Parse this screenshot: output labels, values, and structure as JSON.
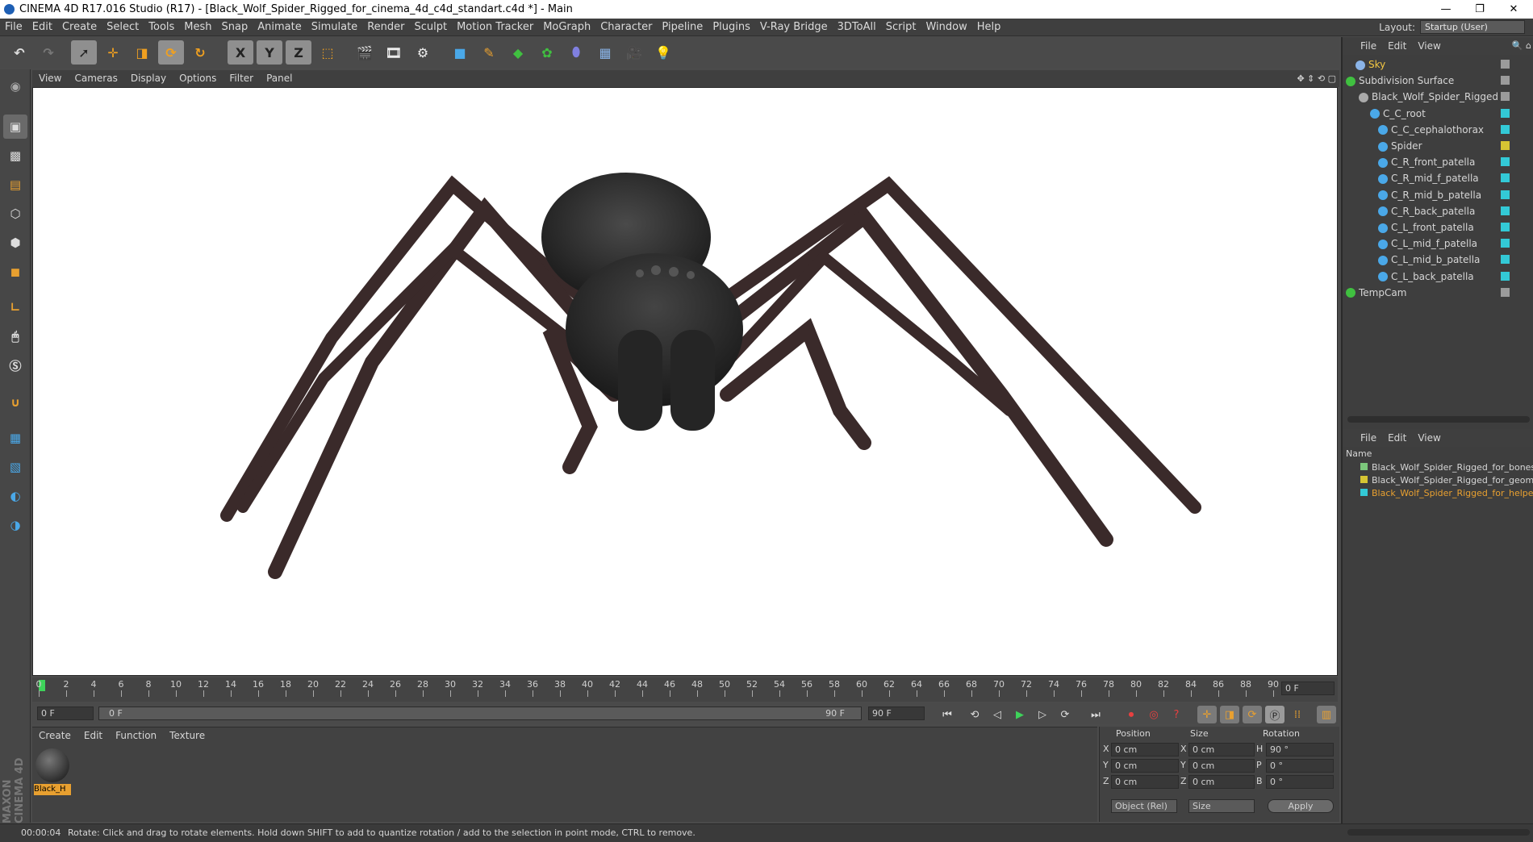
{
  "window": {
    "title": "CINEMA 4D R17.016 Studio (R17) - [Black_Wolf_Spider_Rigged_for_cinema_4d_c4d_standart.c4d *] - Main"
  },
  "menu": [
    "File",
    "Edit",
    "Create",
    "Select",
    "Tools",
    "Mesh",
    "Snap",
    "Animate",
    "Simulate",
    "Render",
    "Sculpt",
    "Motion Tracker",
    "MoGraph",
    "Character",
    "Pipeline",
    "Plugins",
    "V-Ray Bridge",
    "3DToAll",
    "Script",
    "Window",
    "Help"
  ],
  "layout": {
    "label": "Layout:",
    "value": "Startup (User)"
  },
  "toolbar": {
    "x_label": "X",
    "y_label": "Y",
    "z_label": "Z"
  },
  "viewport_menu": [
    "View",
    "Cameras",
    "Display",
    "Options",
    "Filter",
    "Panel"
  ],
  "object_manager": {
    "menu": [
      "File",
      "Edit",
      "View"
    ],
    "objects": [
      {
        "name": "Sky",
        "tag": "#9b9b9b",
        "highlight": "#f5c842"
      },
      {
        "name": "Subdivision Surface",
        "tag": "#9b9b9b"
      },
      {
        "name": "Black_Wolf_Spider_Rigged",
        "tag": "#9b9b9b"
      },
      {
        "name": "C_C_root",
        "tag": "#33c9d6"
      },
      {
        "name": "C_C_cephalothorax",
        "tag": "#33c9d6"
      },
      {
        "name": "Spider",
        "tag": "#d6c533"
      },
      {
        "name": "C_R_front_patella",
        "tag": "#33c9d6"
      },
      {
        "name": "C_R_mid_f_patella",
        "tag": "#33c9d6"
      },
      {
        "name": "C_R_mid_b_patella",
        "tag": "#33c9d6"
      },
      {
        "name": "C_R_back_patella",
        "tag": "#33c9d6"
      },
      {
        "name": "C_L_front_patella",
        "tag": "#33c9d6"
      },
      {
        "name": "C_L_mid_f_patella",
        "tag": "#33c9d6"
      },
      {
        "name": "C_L_mid_b_patella",
        "tag": "#33c9d6"
      },
      {
        "name": "C_L_back_patella",
        "tag": "#33c9d6"
      },
      {
        "name": "TempCam",
        "tag": "#9b9b9b"
      }
    ]
  },
  "layer_manager": {
    "menu": [
      "File",
      "Edit",
      "View"
    ],
    "column": "Name",
    "layers": [
      {
        "name": "Black_Wolf_Spider_Rigged_for_bones",
        "color": "#7cc87c"
      },
      {
        "name": "Black_Wolf_Spider_Rigged_for_geom",
        "color": "#d6c533"
      },
      {
        "name": "Black_Wolf_Spider_Rigged_for_helpe",
        "color": "#33c9d6"
      }
    ]
  },
  "timeline": {
    "ticks": [
      "0",
      "2",
      "4",
      "6",
      "8",
      "10",
      "12",
      "14",
      "16",
      "18",
      "20",
      "22",
      "24",
      "26",
      "28",
      "30",
      "32",
      "34",
      "36",
      "38",
      "40",
      "42",
      "44",
      "46",
      "48",
      "50",
      "52",
      "54",
      "56",
      "58",
      "60",
      "62",
      "64",
      "66",
      "68",
      "70",
      "72",
      "74",
      "76",
      "78",
      "80",
      "82",
      "84",
      "86",
      "88",
      "90"
    ],
    "current_frame": "0 F"
  },
  "playbar": {
    "start": "0 F",
    "slider_start": "0 F",
    "slider_end": "90 F",
    "end": "90 F"
  },
  "material_manager": {
    "menu": [
      "Create",
      "Edit",
      "Function",
      "Texture"
    ],
    "material_name": "Black_H"
  },
  "coordinates": {
    "headers": [
      "Position",
      "Size",
      "Rotation"
    ],
    "rows": [
      {
        "axis": "X",
        "pos": "0 cm",
        "size_axis": "X",
        "size": "0 cm",
        "rot_axis": "H",
        "rot": "90 °"
      },
      {
        "axis": "Y",
        "pos": "0 cm",
        "size_axis": "Y",
        "size": "0 cm",
        "rot_axis": "P",
        "rot": "0 °"
      },
      {
        "axis": "Z",
        "pos": "0 cm",
        "size_axis": "Z",
        "size": "0 cm",
        "rot_axis": "B",
        "rot": "0 °"
      }
    ],
    "mode": "Object (Rel)",
    "size_mode": "Size",
    "apply": "Apply"
  },
  "status": {
    "time": "00:00:04",
    "message": "Rotate: Click and drag to rotate elements. Hold down SHIFT to add to quantize rotation / add to the selection in point mode, CTRL to remove."
  },
  "brand": "MAXON CINEMA 4D"
}
